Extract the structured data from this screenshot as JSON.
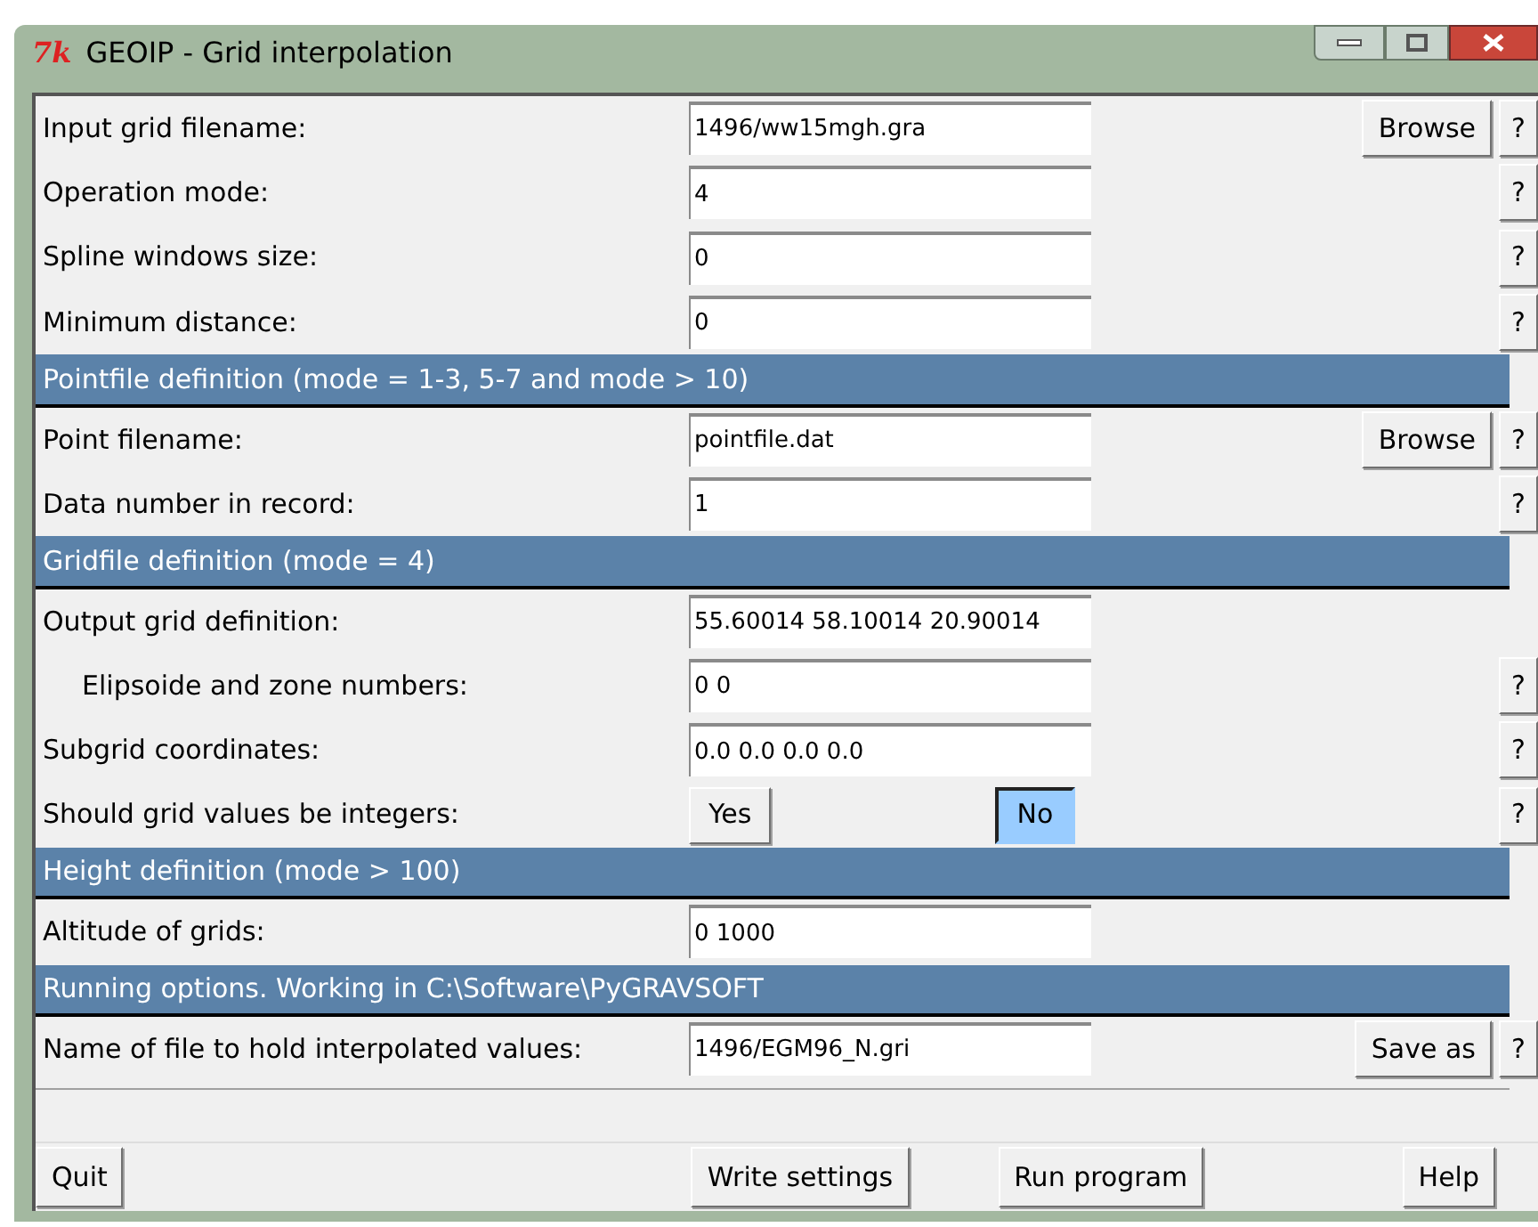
{
  "window": {
    "title": "GEOIP - Grid interpolation",
    "icon_text": "7k"
  },
  "rows": [
    {
      "kind": "field",
      "label": "Input grid filename:",
      "value": "1496/ww15mgh.gra",
      "button": "Browse",
      "help": "?"
    },
    {
      "kind": "field",
      "label": "Operation mode:",
      "value": "4",
      "help": "?"
    },
    {
      "kind": "field",
      "label": "Spline windows size:",
      "value": "0",
      "help": "?"
    },
    {
      "kind": "field",
      "label": "Minimum distance:",
      "value": "0",
      "help": "?"
    },
    {
      "kind": "header",
      "label": "Pointfile definition (mode = 1-3, 5-7 and mode > 10)"
    },
    {
      "kind": "field",
      "label": "Point filename:",
      "value": "pointfile.dat",
      "button": "Browse",
      "help": "?"
    },
    {
      "kind": "field",
      "label": "Data number in record:",
      "value": "1",
      "help": "?"
    },
    {
      "kind": "header",
      "label": "Gridfile definition (mode = 4)"
    },
    {
      "kind": "field",
      "label": "Output grid definition:",
      "value": "55.60014 58.10014 20.90014"
    },
    {
      "kind": "subfield",
      "label": "Elipsoide and zone numbers:",
      "value": "0 0",
      "help": "?"
    },
    {
      "kind": "field",
      "label": "Subgrid coordinates:",
      "value": "0.0 0.0 0.0 0.0",
      "help": "?"
    },
    {
      "kind": "toggle",
      "label": "Should grid values be integers:",
      "options": [
        {
          "label": "Yes",
          "selected": false
        },
        {
          "label": "No",
          "selected": true
        }
      ],
      "help": "?"
    },
    {
      "kind": "header",
      "label": "Height definition (mode > 100)"
    },
    {
      "kind": "field",
      "label": "Altitude of grids:",
      "value": "0 1000"
    },
    {
      "kind": "header",
      "label": "Running options. Working in C:\\Software\\PyGRAVSOFT"
    },
    {
      "kind": "field",
      "label": "Name of file to hold interpolated values:",
      "value": "1496/EGM96_N.gri",
      "button": "Save as",
      "help": "?"
    },
    {
      "kind": "status"
    }
  ],
  "footer_buttons": [
    "Quit",
    "Write settings",
    "Run program",
    "Help"
  ]
}
